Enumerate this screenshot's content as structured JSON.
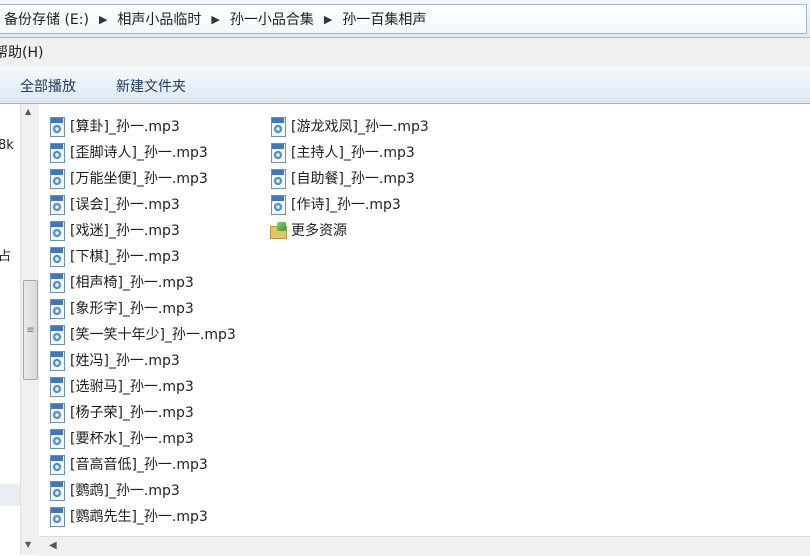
{
  "address": {
    "crumbs": [
      "备份存储 (E:)",
      "相声小品临时",
      "孙一小品合集",
      "孙一百集相声"
    ],
    "separator": "▶"
  },
  "menubar": {
    "help_label": "帮助(H)"
  },
  "toolbar": {
    "play_all_label": "全部播放",
    "new_folder_label": "新建文件夹"
  },
  "left_pane": {
    "fragment_1": "8k",
    "fragment_2": "占"
  },
  "files": {
    "column_1": [
      "[算卦]_孙一.mp3",
      "[歪脚诗人]_孙一.mp3",
      "[万能坐便]_孙一.mp3",
      "[误会]_孙一.mp3",
      "[戏迷]_孙一.mp3",
      "[下棋]_孙一.mp3",
      "[相声椅]_孙一.mp3",
      "[象形字]_孙一.mp3",
      "[笑一笑十年少]_孙一.mp3",
      "[姓冯]_孙一.mp3",
      "[选驸马]_孙一.mp3",
      "[杨子荣]_孙一.mp3",
      "[要杯水]_孙一.mp3",
      "[音高音低]_孙一.mp3",
      "[鹦鹉]_孙一.mp3",
      "[鹦鹉先生]_孙一.mp3"
    ],
    "column_2": [
      "[游龙戏凤]_孙一.mp3",
      "[主持人]_孙一.mp3",
      "[自助餐]_孙一.mp3",
      "[作诗]_孙一.mp3"
    ],
    "more_resources": "更多资源"
  },
  "icons": {
    "audio_file": "mp3-file-icon",
    "shortcut": "shortcut-icon"
  },
  "colors": {
    "toolbar_text": "#1e3a5a",
    "file_icon_band": "#3c78c4"
  }
}
